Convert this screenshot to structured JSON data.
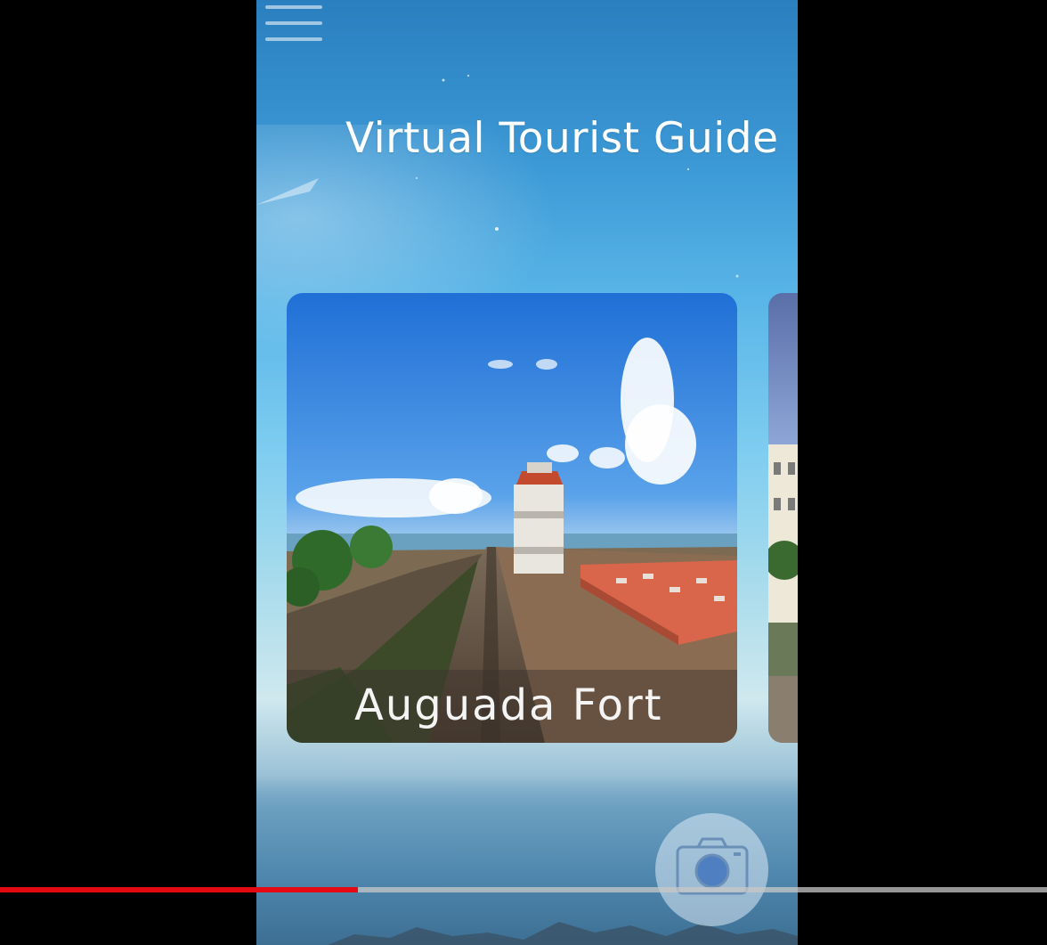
{
  "app": {
    "title": "Virtual Tourist Guide"
  },
  "carousel": {
    "cards": [
      {
        "label": "Auguada Fort"
      },
      {
        "label": ""
      }
    ]
  },
  "video_player": {
    "progress_fraction": 0.342,
    "progress_color": "#e50914"
  },
  "icons": {
    "menu": "hamburger-menu-icon",
    "camera": "camera-icon"
  }
}
